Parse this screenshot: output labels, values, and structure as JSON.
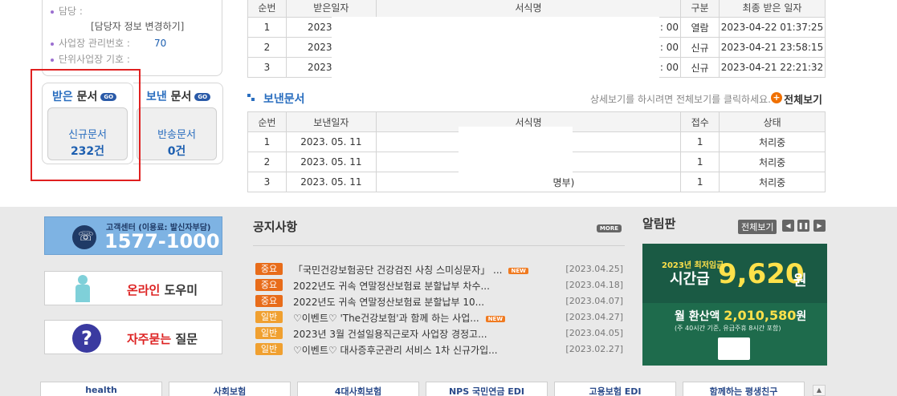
{
  "info": {
    "manager_label": "담당 :",
    "change_link": "[담당자 정보 변경하기]",
    "biz_no_label": "사업장 관리번호 :",
    "biz_no_value": "70",
    "unit_label": "단위사업장 기호 :"
  },
  "received": {
    "title_a": "받은",
    "title_b": "문서",
    "go": "GO",
    "box_label": "신규문서",
    "box_count": "232건"
  },
  "sent_card": {
    "title_a": "보낸",
    "title_b": "문서",
    "go": "GO",
    "box_label": "반송문서",
    "box_count": "0건"
  },
  "received_table": {
    "headers": [
      "순번",
      "받은일자",
      "서식명",
      "구분",
      "최종 받은 일자"
    ],
    "rows": [
      {
        "no": "1",
        "date": "2023.",
        "time": ": 00",
        "type": "열람",
        "last": "2023-04-22 01:37:25"
      },
      {
        "no": "2",
        "date": "2023.",
        "time": ": 00",
        "type": "신규",
        "last": "2023-04-21 23:58:15"
      },
      {
        "no": "3",
        "date": "2023.",
        "time": ": 00",
        "type": "신규",
        "last": "2023-04-21 22:21:32"
      }
    ]
  },
  "sent_section": {
    "title": "보낸문서",
    "hint": "상세보기를 하시려면 전체보기를 클릭하세요.",
    "plus": "+",
    "view_all": "전체보기"
  },
  "sent_table": {
    "headers": [
      "순번",
      "보낸일자",
      "서식명",
      "접수",
      "상태"
    ],
    "rows": [
      {
        "no": "1",
        "date": "2023. 05. 11",
        "form": "",
        "recv": "1",
        "status": "처리중"
      },
      {
        "no": "2",
        "date": "2023. 05. 11",
        "form": "",
        "recv": "1",
        "status": "처리중"
      },
      {
        "no": "3",
        "date": "2023. 05. 11",
        "form": "명부)",
        "recv": "1",
        "status": "처리중"
      }
    ]
  },
  "callcenter": {
    "sub": "고객센터 (이용료: 발신자부담)",
    "number": "1577-1000"
  },
  "helper": {
    "red": "온라인",
    "black": "도우미"
  },
  "faq": {
    "red": "자주묻는",
    "black": "질문"
  },
  "notice": {
    "title": "공지사항",
    "more": "MORE",
    "items": [
      {
        "tag": "중요",
        "kind": "imp",
        "text": "「국민건강보험공단 건강검진 사칭 스미싱문자」 ...",
        "new": "NEW",
        "date": "[2023.04.25]"
      },
      {
        "tag": "중요",
        "kind": "imp",
        "text": "2022년도 귀속 연말정산보험료 분할납부 차수...",
        "new": "",
        "date": "[2023.04.18]"
      },
      {
        "tag": "중요",
        "kind": "imp",
        "text": "2022년도 귀속 연말정산보험료 분할납부 10...",
        "new": "",
        "date": "[2023.04.07]"
      },
      {
        "tag": "일반",
        "kind": "gen",
        "text": "♡이벤트♡ 'The건강보험'과 함께 하는 사업...",
        "new": "NEW",
        "date": "[2023.04.27]"
      },
      {
        "tag": "일반",
        "kind": "gen",
        "text": "2023년 3월 건설일용직근로자 사업장 경정고...",
        "new": "",
        "date": "[2023.04.05]"
      },
      {
        "tag": "일반",
        "kind": "gen",
        "text": "♡이벤트♡ 대사증후군관리 서비스 1차 신규가입...",
        "new": "",
        "date": "[2023.02.27]"
      }
    ]
  },
  "alarm": {
    "title": "알림판",
    "view_all": "전체보기",
    "prev": "◀",
    "pause": "❚❚",
    "next": "▶",
    "banner": {
      "year_text": "2023년 최저임금",
      "hourly": "시간급",
      "amount": "9,620",
      "won": "원",
      "monthly_label": "월 환산액",
      "monthly_amount": "2,010,580",
      "monthly_won": "원",
      "note": "(주 40시간 기준, 유급주휴 8시간 포함)"
    }
  },
  "bottom_logos": [
    "health",
    "사회보험",
    "4대사회보험",
    "NPS 국민연금 EDI",
    "고용보험 EDI",
    "함께하는 평생친구"
  ],
  "scroll_up": "▲"
}
